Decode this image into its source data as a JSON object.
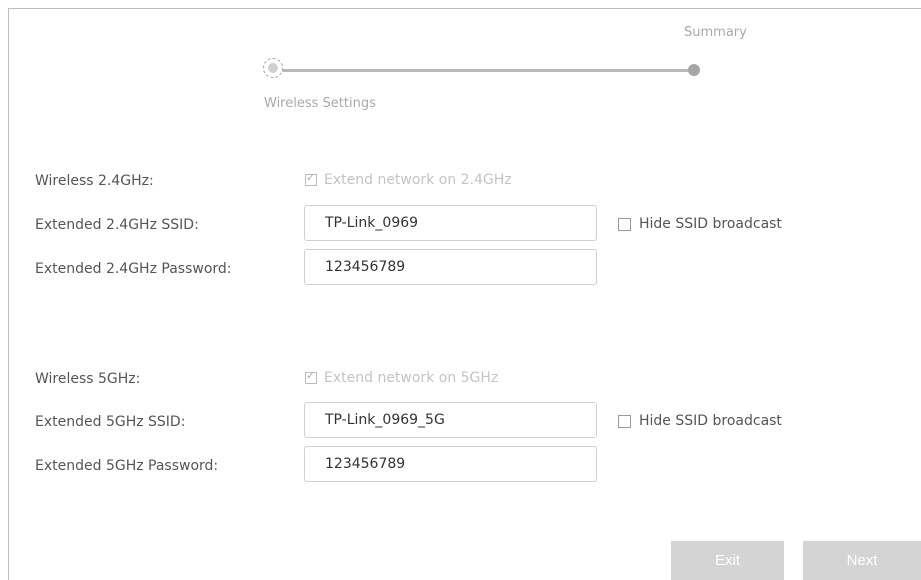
{
  "stepper": {
    "steps": [
      "Wireless Settings",
      "Summary"
    ]
  },
  "wireless24": {
    "label": "Wireless 2.4GHz:",
    "extend_label": "Extend network on 2.4GHz",
    "extend_checked": true,
    "ssid_label": "Extended 2.4GHz SSID:",
    "ssid_value": "TP-Link_0969",
    "hide_ssid_label": "Hide SSID broadcast",
    "hide_ssid_checked": false,
    "password_label": "Extended 2.4GHz Password:",
    "password_value": "123456789"
  },
  "wireless5": {
    "label": "Wireless 5GHz:",
    "extend_label": "Extend network on 5GHz",
    "extend_checked": true,
    "ssid_label": "Extended 5GHz SSID:",
    "ssid_value": "TP-Link_0969_5G",
    "hide_ssid_label": "Hide SSID broadcast",
    "hide_ssid_checked": false,
    "password_label": "Extended 5GHz Password:",
    "password_value": "123456789"
  },
  "buttons": {
    "exit_label": "Exit",
    "next_label": "Next"
  },
  "icons": {
    "checkbox": "checkbox-icon",
    "step_active": "step-active-dot-icon",
    "step_pending": "step-dot-icon"
  }
}
